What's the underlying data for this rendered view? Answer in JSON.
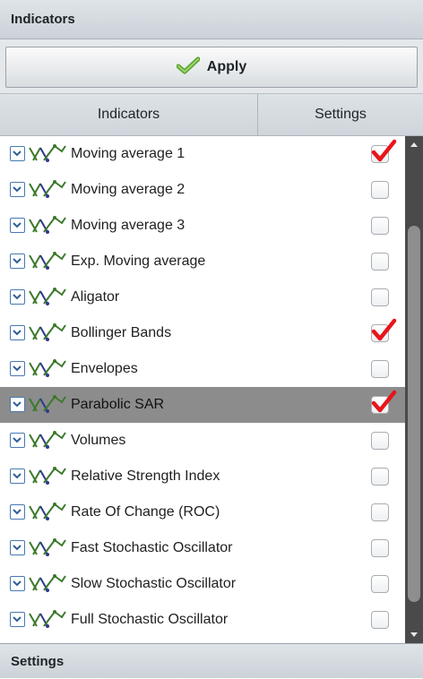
{
  "panel": {
    "title": "Indicators",
    "apply_label": "Apply",
    "footer_title": "Settings"
  },
  "columns": {
    "indicators": "Indicators",
    "settings": "Settings"
  },
  "colors": {
    "checkmark": "#e8141b",
    "selected_row": "#8c8c8c",
    "expand_border": "#4879b4",
    "apply_check": "#7cc242"
  },
  "icons": {
    "expand": "chevron-down-icon",
    "indicator": "indicator-chart-icon",
    "apply": "checkmark-icon"
  },
  "indicators": [
    {
      "label": "Moving average 1",
      "checked": true,
      "selected": false
    },
    {
      "label": "Moving average 2",
      "checked": false,
      "selected": false
    },
    {
      "label": "Moving average 3",
      "checked": false,
      "selected": false
    },
    {
      "label": "Exp. Moving average",
      "checked": false,
      "selected": false
    },
    {
      "label": "Aligator",
      "checked": false,
      "selected": false
    },
    {
      "label": "Bollinger Bands",
      "checked": true,
      "selected": false
    },
    {
      "label": "Envelopes",
      "checked": false,
      "selected": false
    },
    {
      "label": "Parabolic SAR",
      "checked": true,
      "selected": true
    },
    {
      "label": "Volumes",
      "checked": false,
      "selected": false
    },
    {
      "label": "Relative Strength Index",
      "checked": false,
      "selected": false
    },
    {
      "label": "Rate Of Change (ROC)",
      "checked": false,
      "selected": false
    },
    {
      "label": "Fast Stochastic Oscillator",
      "checked": false,
      "selected": false
    },
    {
      "label": "Slow Stochastic Oscillator",
      "checked": false,
      "selected": false
    },
    {
      "label": "Full Stochastic Oscillator",
      "checked": false,
      "selected": false
    },
    {
      "label": "",
      "checked": false,
      "selected": false
    }
  ]
}
